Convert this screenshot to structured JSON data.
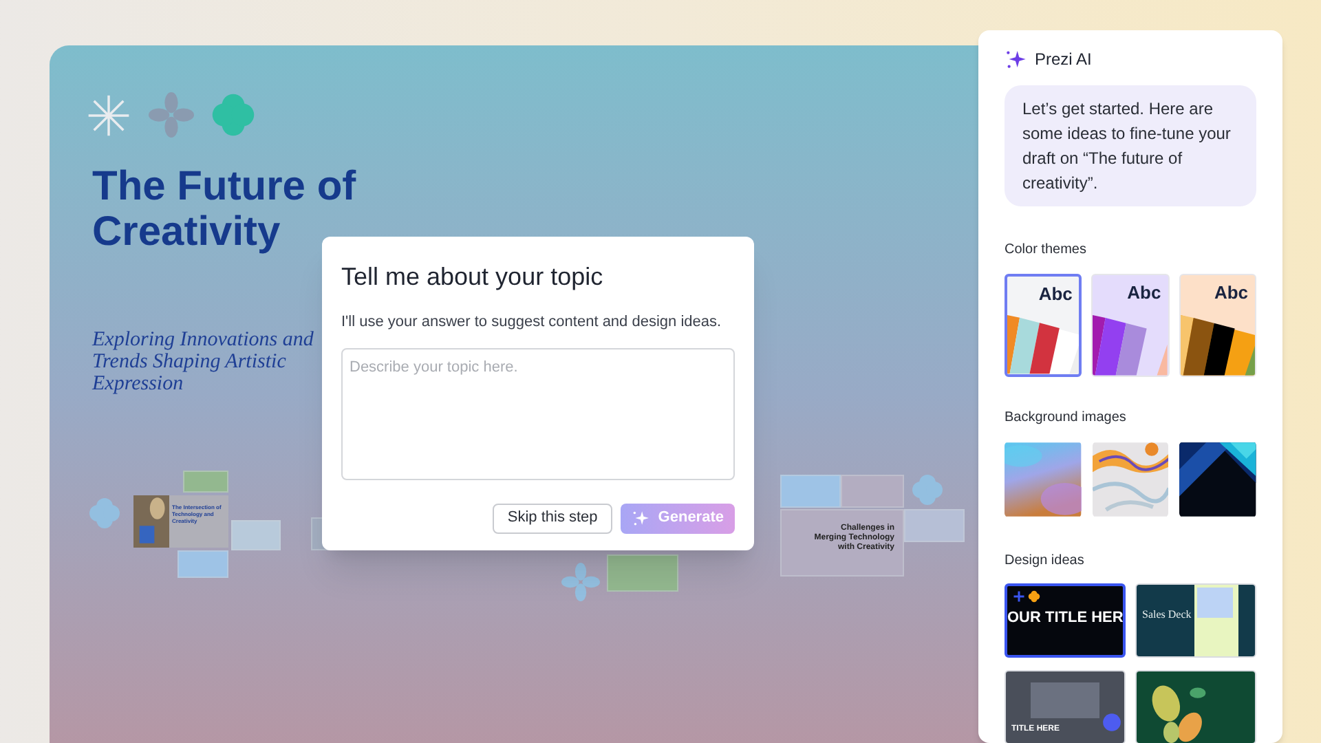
{
  "slide": {
    "title": "The Future of Creativity",
    "subtitle": "Exploring Innovations and Trends Shaping Artistic Expression"
  },
  "overview_slides": [
    {
      "title": "The Intersection of Technology and Creativity"
    },
    {
      "title": "Challenges in Merging Technology with Creativity"
    }
  ],
  "dialog": {
    "title": "Tell me about your topic",
    "description": "I'll use your answer to suggest content and design ideas.",
    "placeholder": "Describe your topic here.",
    "buttons": [
      {
        "label": "Skip this step",
        "kind": "secondary"
      },
      {
        "label": "Generate",
        "kind": "primary"
      }
    ]
  },
  "panel": {
    "title": "Prezi AI",
    "message": "Let’s get started. Here are some ideas to fine-tune your draft on “The future of creativity”.",
    "color_themes": {
      "heading": "Color themes",
      "items": [
        {
          "label": "Abc",
          "selected": true
        },
        {
          "label": "Abc",
          "selected": false
        },
        {
          "label": "Abc",
          "selected": false
        }
      ]
    },
    "background_images": {
      "heading": "Background images"
    },
    "design_ideas": {
      "heading": "Design ideas",
      "items": [
        {
          "kind": "bold",
          "title": "OUR TITLE HER",
          "selected": true
        },
        {
          "kind": "deck",
          "title": "Sales Deck",
          "selected": false
        },
        {
          "kind": "grey",
          "title": "TITLE HERE",
          "selected": false
        },
        {
          "kind": "leaves",
          "selected": false
        }
      ]
    }
  }
}
